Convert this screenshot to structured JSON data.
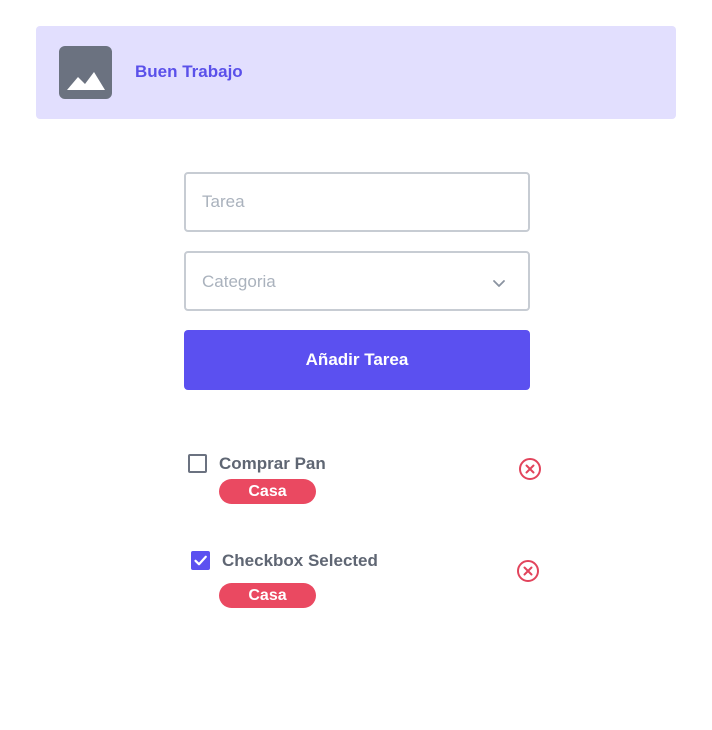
{
  "banner": {
    "title": "Buen Trabajo",
    "image_icon": "image-placeholder-icon"
  },
  "form": {
    "task_placeholder": "Tarea",
    "task_value": "",
    "category_placeholder": "Categoria",
    "category_icon": "chevron-down-icon",
    "add_button_label": "Añadir Tarea"
  },
  "tasks": [
    {
      "label": "Comprar Pan",
      "category": "Casa",
      "checked": false,
      "delete_icon": "close-circle-icon"
    },
    {
      "label": "Checkbox Selected",
      "category": "Casa",
      "checked": true,
      "delete_icon": "close-circle-icon"
    }
  ],
  "colors": {
    "accent": "#5b50f0",
    "banner_background": "#e2dffe",
    "tag": "#ea4961",
    "delete": "#e2445c"
  }
}
